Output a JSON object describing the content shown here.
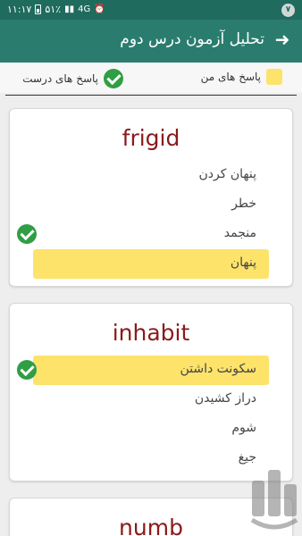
{
  "status_bar": {
    "time": "۱۱:۱۷",
    "battery": "۵۱٪",
    "network": "4G",
    "notification_count": "۷"
  },
  "app_bar": {
    "title": "تحلیل آزمون درس دوم",
    "back_icon": "arrow-right-icon"
  },
  "legend": {
    "mine_label": "پاسخ های من",
    "correct_label": "پاسخ های درست",
    "mine_color": "#fde36a",
    "correct_color": "#2f9e44"
  },
  "questions": [
    {
      "word": "frigid",
      "options": [
        {
          "text": "پنهان کردن",
          "selected": false,
          "correct": false
        },
        {
          "text": "خطر",
          "selected": false,
          "correct": false
        },
        {
          "text": "منجمد",
          "selected": false,
          "correct": true
        },
        {
          "text": "پنهان",
          "selected": true,
          "correct": false
        }
      ]
    },
    {
      "word": "inhabit",
      "options": [
        {
          "text": "سکونت داشتن",
          "selected": true,
          "correct": true
        },
        {
          "text": "دراز کشیدن",
          "selected": false,
          "correct": false
        },
        {
          "text": "شوم",
          "selected": false,
          "correct": false
        },
        {
          "text": "جیغ",
          "selected": false,
          "correct": false
        }
      ]
    },
    {
      "word": "numb",
      "options": []
    }
  ],
  "watermark": {
    "icon": "app-logo-watermark"
  }
}
